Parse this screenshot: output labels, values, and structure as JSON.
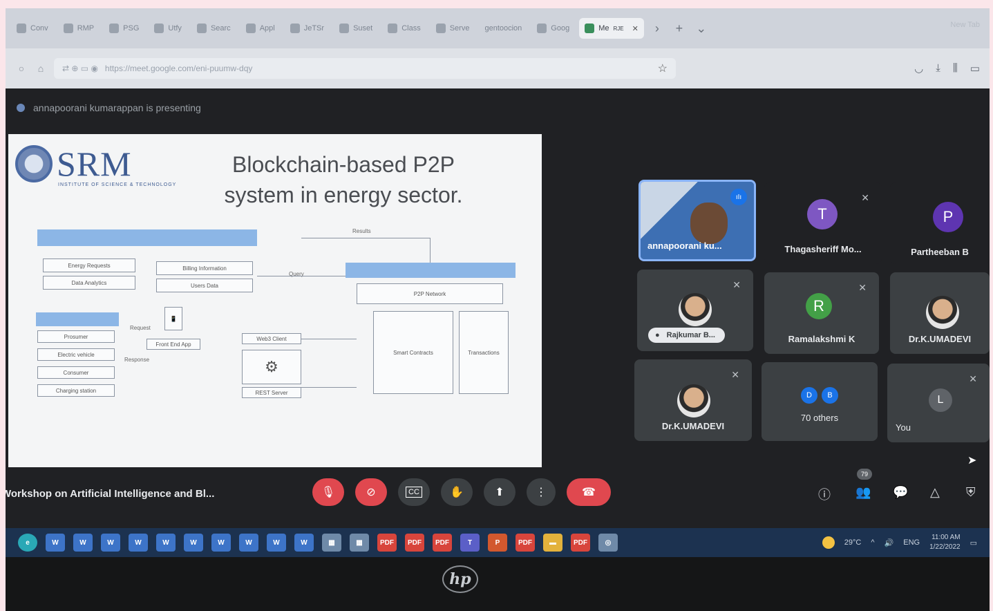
{
  "browser": {
    "tabs": [
      {
        "label": "Conv"
      },
      {
        "label": "RMP"
      },
      {
        "label": "PSG"
      },
      {
        "label": "Utfy"
      },
      {
        "label": "Searc"
      },
      {
        "label": "Appl"
      },
      {
        "label": "JeTSr"
      },
      {
        "label": "Suset"
      },
      {
        "label": "Class"
      },
      {
        "label": "Serve"
      },
      {
        "label": "gentoocion"
      },
      {
        "label": "Goog"
      }
    ],
    "active_tab": {
      "label": "Me",
      "sub": "RJE"
    },
    "window_title": "New Tab",
    "url": "https://meet.google.com/eni-puumw-dqy"
  },
  "meet": {
    "presenting_text": "annapoorani kumarappan is presenting",
    "meeting_title": "Workshop on Artificial Intelligence and Bl...",
    "participant_count": "79",
    "participants": [
      {
        "name": "annapoorani ku...",
        "kind": "camera"
      },
      {
        "name": "Thagasheriff Mo...",
        "initial": "T",
        "color": "#7e57c2"
      },
      {
        "name": "Partheeban B",
        "initial": "P",
        "color": "#5e35b1"
      },
      {
        "name": "Rajkumar B...",
        "kind": "photo"
      },
      {
        "name": "Ramalakshmi K",
        "initial": "R",
        "color": "#43a047"
      },
      {
        "name": "Dr.K.UMADEVI",
        "kind": "photo"
      },
      {
        "name": "Dr.K.UMADEVI",
        "kind": "photo"
      },
      {
        "name": "70 others",
        "initials": [
          "D",
          "B"
        ]
      },
      {
        "name": "You",
        "initial": "L",
        "color": "#5f6368"
      }
    ]
  },
  "slide": {
    "logo_text": "SRM",
    "logo_subtitle": "INSTITUTE OF SCIENCE & TECHNOLOGY",
    "title_line1": "Blockchain-based P2P",
    "title_line2": "system in energy sector.",
    "diagram": {
      "results": "Results",
      "energy_requests": "Energy Requests",
      "data_analytics": "Data Analytics",
      "billing_information": "Billing Information",
      "users_data": "Users Data",
      "query": "Query",
      "request": "Request",
      "prosumer": "Prosumer",
      "electric_vehicle": "Electric vehicle",
      "consumer": "Consumer",
      "charging_station": "Charging station",
      "front_end_app": "Front End App",
      "response": "Response",
      "web_client": "Web3 Client",
      "rest_server": "REST Server",
      "p2p_network": "P2P Network",
      "smart_contracts": "Smart Contracts",
      "transactions": "Transactions"
    }
  },
  "controls": {
    "mic": "mic-off",
    "cam": "camera-off",
    "captions": "CC",
    "hand": "raise-hand",
    "present": "present",
    "more": "more",
    "leave": "leave"
  },
  "taskbar": {
    "weather": "29°C",
    "language": "ENG",
    "time": "11:00 AM",
    "date": "1/22/2022"
  },
  "bezel": {
    "logo": "hp"
  }
}
